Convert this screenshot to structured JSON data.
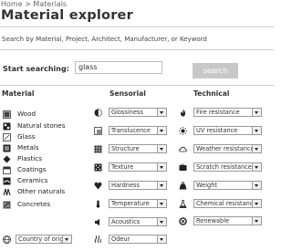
{
  "breadcrumb": "Home > Materials",
  "title": "Material explorer",
  "subtitle": "Search by Material, Project, Architect, Manufacturer, or Keyword",
  "search": {
    "label": "Start searching:",
    "value": "glass",
    "button": "search"
  },
  "columns": {
    "material": "Material",
    "sensorial": "Sensorial",
    "technical": "Technical"
  },
  "materials": [
    {
      "label": "Wood",
      "icon": "wood-icon"
    },
    {
      "label": "Natural stones",
      "icon": "natural-stones-icon"
    },
    {
      "label": "Glass",
      "icon": "glass-icon"
    },
    {
      "label": "Metals",
      "icon": "metals-icon"
    },
    {
      "label": "Plastics",
      "icon": "plastics-icon"
    },
    {
      "label": "Coatings",
      "icon": "coatings-icon"
    },
    {
      "label": "Ceramics",
      "icon": "ceramics-icon"
    },
    {
      "label": "Other naturals",
      "icon": "other-naturals-icon"
    },
    {
      "label": "Concretes",
      "icon": "concretes-icon"
    }
  ],
  "sensorial": [
    "Glossiness",
    "Translucence",
    "Structure",
    "Texture",
    "Hardness",
    "Temperature",
    "Acoustics",
    "Odeur"
  ],
  "technical": [
    "Fire resistance",
    "UV resistance",
    "Weather resistance",
    "Scratch resistance",
    "Weight",
    "Chemical resistance",
    "Renewable"
  ],
  "country": "Country of origin"
}
